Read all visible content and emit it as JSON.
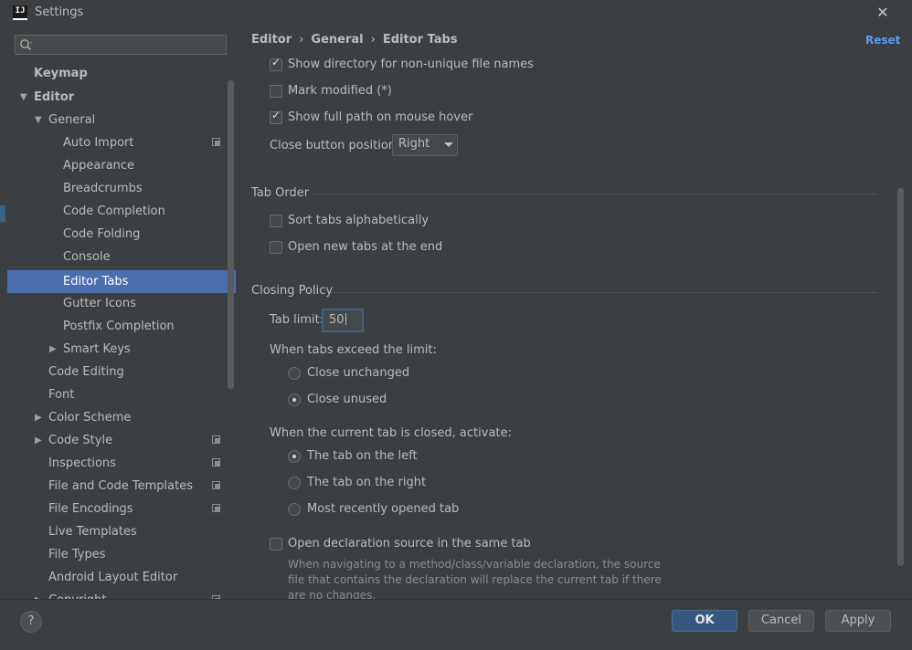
{
  "window": {
    "title": "Settings",
    "app_icon_text": "IJ",
    "close_label": "✕"
  },
  "sidebar": {
    "search_placeholder": "",
    "items": [
      {
        "label": "Keymap",
        "level": 0,
        "bold": true
      },
      {
        "label": "Editor",
        "level": 0,
        "bold": true,
        "expanded": true
      },
      {
        "label": "General",
        "level": 1,
        "expanded": true
      },
      {
        "label": "Auto Import",
        "level": 2,
        "project_icon": true
      },
      {
        "label": "Appearance",
        "level": 2
      },
      {
        "label": "Breadcrumbs",
        "level": 2
      },
      {
        "label": "Code Completion",
        "level": 2
      },
      {
        "label": "Code Folding",
        "level": 2
      },
      {
        "label": "Console",
        "level": 2
      },
      {
        "label": "Editor Tabs",
        "level": 2,
        "selected": true
      },
      {
        "label": "Gutter Icons",
        "level": 2
      },
      {
        "label": "Postfix Completion",
        "level": 2
      },
      {
        "label": "Smart Keys",
        "level": 2,
        "collapsed": true
      },
      {
        "label": "Code Editing",
        "level": 1
      },
      {
        "label": "Font",
        "level": 1
      },
      {
        "label": "Color Scheme",
        "level": 1,
        "collapsed": true
      },
      {
        "label": "Code Style",
        "level": 1,
        "collapsed": true,
        "project_icon": true
      },
      {
        "label": "Inspections",
        "level": 1,
        "project_icon": true
      },
      {
        "label": "File and Code Templates",
        "level": 1,
        "project_icon": true
      },
      {
        "label": "File Encodings",
        "level": 1,
        "project_icon": true
      },
      {
        "label": "Live Templates",
        "level": 1
      },
      {
        "label": "File Types",
        "level": 1
      },
      {
        "label": "Android Layout Editor",
        "level": 1
      },
      {
        "label": "Copyright",
        "level": 1,
        "collapsed": true,
        "project_icon": true
      }
    ]
  },
  "breadcrumb": {
    "parts": [
      "Editor",
      "General",
      "Editor Tabs"
    ],
    "separator": "›"
  },
  "reset_label": "Reset",
  "options": {
    "show_directory": {
      "label": "Show directory for non-unique file names",
      "checked": true
    },
    "mark_modified": {
      "label": "Mark modified (*)",
      "checked": false
    },
    "show_full_path": {
      "label": "Show full path on mouse hover",
      "checked": true
    },
    "close_button_position": {
      "label": "Close button position:",
      "value": "Right"
    }
  },
  "tab_order": {
    "title": "Tab Order",
    "sort_alphabetically": {
      "label": "Sort tabs alphabetically",
      "checked": false
    },
    "open_at_end": {
      "label": "Open new tabs at the end",
      "checked": false
    }
  },
  "closing_policy": {
    "title": "Closing Policy",
    "tab_limit_label": "Tab limit:",
    "tab_limit_value": "50",
    "exceed_label": "When tabs exceed the limit:",
    "close_unchanged": {
      "label": "Close unchanged",
      "selected": false
    },
    "close_unused": {
      "label": "Close unused",
      "selected": true
    },
    "activate_label": "When the current tab is closed, activate:",
    "tab_left": {
      "label": "The tab on the left",
      "selected": true
    },
    "tab_right": {
      "label": "The tab on the right",
      "selected": false
    },
    "most_recent": {
      "label": "Most recently opened tab",
      "selected": false
    },
    "open_declaration": {
      "label": "Open declaration source in the same tab",
      "checked": false
    },
    "open_declaration_help": "When navigating to a method/class/variable declaration, the source file that contains the declaration will replace the current tab if there are no changes."
  },
  "footer": {
    "help_label": "?",
    "ok_label": "OK",
    "cancel_label": "Cancel",
    "apply_label": "Apply"
  }
}
